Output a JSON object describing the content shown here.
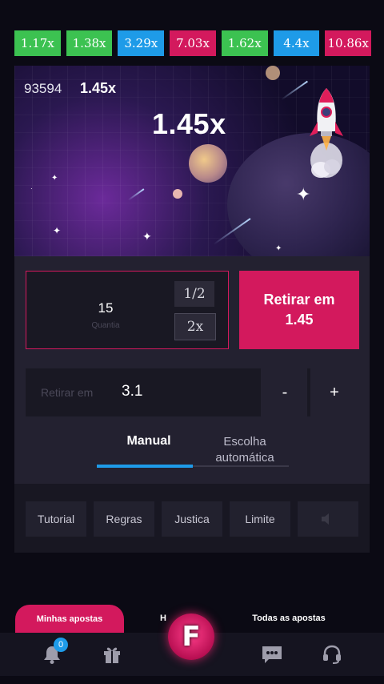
{
  "history": [
    {
      "value": "1.17x",
      "color": "green"
    },
    {
      "value": "1.38x",
      "color": "green"
    },
    {
      "value": "3.29x",
      "color": "blue"
    },
    {
      "value": "7.03x",
      "color": "pink"
    },
    {
      "value": "1.62x",
      "color": "green"
    },
    {
      "value": "4.4x",
      "color": "blue"
    },
    {
      "value": "10.86x",
      "color": "pink"
    }
  ],
  "game": {
    "round_counter": "93594",
    "current_multiplier_small": "1.45x",
    "current_multiplier_big": "1.45x"
  },
  "bet": {
    "amount": "15",
    "amount_label": "Quantia",
    "half_label": "1/2",
    "double_label": "2x",
    "cashout_line1": "Retirar em",
    "cashout_line2": "1.45"
  },
  "autocashout": {
    "label": "Retirar em",
    "value": "3.1",
    "minus": "-",
    "plus": "+"
  },
  "mode_tabs": {
    "manual": "Manual",
    "auto_line1": "Escolha",
    "auto_line2": "automática"
  },
  "info_buttons": [
    "Tutorial",
    "Regras",
    "Justica",
    "Limite"
  ],
  "bottom_tabs": {
    "my_bets": "Minhas apostas",
    "history": "H",
    "all_bets": "Todas as apostas"
  },
  "nav": {
    "notification_count": "0",
    "logo_letter": "F"
  },
  "colors": {
    "green": "#3cc251",
    "blue": "#1e9be8",
    "pink": "#d3195d"
  }
}
